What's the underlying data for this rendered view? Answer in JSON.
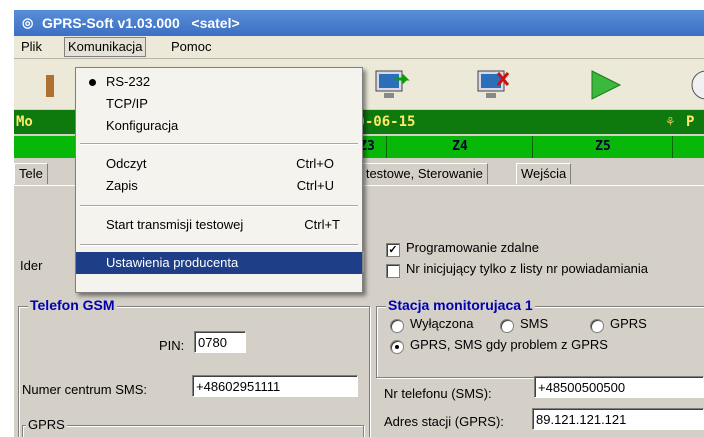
{
  "window": {
    "title": "GPRS-Soft v1.03.000   <satel>"
  },
  "menubar": {
    "items": [
      "Plik",
      "Komunikacja",
      "Pomoc"
    ]
  },
  "status_bar": {
    "left": "Mo",
    "date": "10-06-15",
    "right": "P"
  },
  "zones": [
    "Z3",
    "Z4",
    "Z5"
  ],
  "tabs": [
    "Tele",
    "e testowe, Sterowanie",
    "Wejścia"
  ],
  "dropdown": {
    "items": [
      {
        "label": "RS-232",
        "shortcut": "",
        "checked": true
      },
      {
        "label": "TCP/IP",
        "shortcut": ""
      },
      {
        "label": "Konfiguracja",
        "shortcut": ""
      },
      {
        "label": "Odczyt",
        "shortcut": "Ctrl+O"
      },
      {
        "label": "Zapis",
        "shortcut": "Ctrl+U"
      },
      {
        "label": "Start transmisji testowej",
        "shortcut": "Ctrl+T"
      },
      {
        "label": "Ustawienia producenta",
        "shortcut": ""
      }
    ]
  },
  "form": {
    "ident_label": "Ider",
    "remote_programming": {
      "label": "Programowanie zdalne",
      "checked": true
    },
    "initiating_only": {
      "label": "Nr inicjujący tylko z listy nr powiadamiania",
      "checked": false
    },
    "gsm": {
      "title": "Telefon GSM",
      "pin_label": "PIN:",
      "pin_value": "0780",
      "sms_center_label": "Numer centrum SMS:",
      "sms_center_value": "+48602951111",
      "gprs_label": "GPRS"
    },
    "station": {
      "title": "Stacja monitorujaca 1",
      "radio_off": "Wyłączona",
      "radio_sms": "SMS",
      "radio_gprs": "GPRS",
      "radio_gprs_sms": "GPRS, SMS gdy problem z GPRS",
      "phone_label": "Nr telefonu (SMS):",
      "phone_value": "+48500500500",
      "address_label": "Adres stacji (GPRS):",
      "address_value": "89.121.121.121"
    }
  },
  "colors": {
    "title": "#3a6fc4",
    "status": "#0e7a0e",
    "zones": "#08b808",
    "menu_highlight": "#1e3e88",
    "group_title": "#0000b0"
  }
}
